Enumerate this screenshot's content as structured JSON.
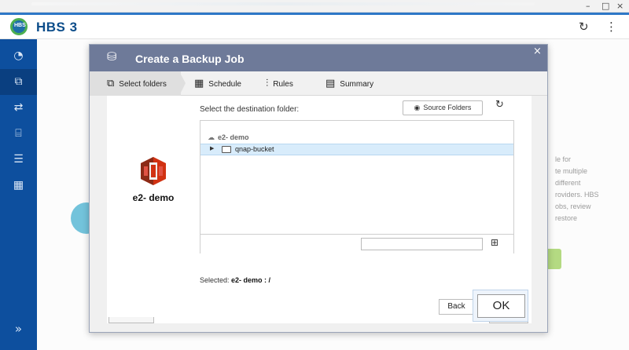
{
  "os": {
    "controls": [
      "–",
      "□",
      "×"
    ]
  },
  "app": {
    "title": "HBS 3",
    "logo_text": "HBS",
    "refresh_icon": "↻",
    "more_icon": "⋮"
  },
  "sidebar": {
    "items": [
      {
        "icon": "dashboard-icon",
        "glyph": "◔"
      },
      {
        "icon": "backup-icon",
        "glyph": "⧉"
      },
      {
        "icon": "sync-icon",
        "glyph": "⇄"
      },
      {
        "icon": "restore-icon",
        "glyph": "⌸"
      },
      {
        "icon": "storage-icon",
        "glyph": "☰"
      },
      {
        "icon": "services-icon",
        "glyph": "▦"
      }
    ],
    "expand": "»"
  },
  "background": {
    "text_lines": [
      "le for",
      "te multiple",
      "different",
      "roviders. HBS",
      "obs, review",
      "restore"
    ]
  },
  "modal": {
    "title": "Create a Backup Job",
    "close": "×",
    "steps": [
      {
        "label": "Select folders",
        "glyph": "⧉"
      },
      {
        "label": "Schedule",
        "glyph": "▦"
      },
      {
        "label": "Rules",
        "glyph": "⫶"
      },
      {
        "label": "Summary",
        "glyph": "▤"
      }
    ],
    "source": {
      "name": "e2- demo"
    },
    "destination": {
      "label": "Select the destination folder:",
      "source_folders_button": "Source Folders",
      "refresh_icon": "↻",
      "tree_root": "e2- demo",
      "tree_items": [
        {
          "label": "qnap-bucket",
          "expanded": false
        }
      ],
      "folder_input_value": "",
      "new_folder_icon": "⊞"
    },
    "selected_prefix": "Selected:",
    "selected_value": "e2- demo : /",
    "back_button": "Back",
    "ok_button": "OK"
  },
  "colors": {
    "accent": "#0d4f9e",
    "modal_header": "#6e7a99",
    "selected_row": "#d8ecfb",
    "s3_red": "#d13212"
  }
}
